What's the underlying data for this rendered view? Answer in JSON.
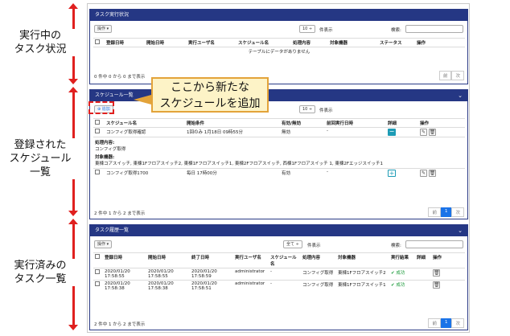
{
  "annotations": {
    "running": "実行中の\nタスク状況",
    "registered": "登録された\nスケジュール\n一覧",
    "executed": "実行済みの\nタスク一覧",
    "callout": "ここから新たな\nスケジュールを追加"
  },
  "colors": {
    "header": "#253784",
    "arrow": "#e0201f",
    "callout_bg": "#fdf3c7",
    "callout_border": "#e3a33a",
    "success": "#1a9a3a",
    "page_active": "#1a73e8"
  },
  "panel1": {
    "title": "タスク実行状況",
    "op_button": "操作 ▾",
    "page_size": "10 ÷",
    "page_size_suffix": "件表示",
    "search_label": "検索:",
    "columns": [
      "登録日時",
      "開始日時",
      "実行ユーザ名",
      "スケジュール名",
      "処理内容",
      "対象機器",
      "ステータス",
      "操作"
    ],
    "empty": "テーブルにデータがありません",
    "info": "0 件中 0 から 0 まで表示",
    "prev": "前",
    "next": "次"
  },
  "panel2": {
    "title": "スケジュール一覧",
    "add_button": "追加",
    "page_size": "10 ÷",
    "page_size_suffix": "件表示",
    "columns": [
      "スケジュール名",
      "開始条件",
      "有効/無効",
      "前回実行日時",
      "詳細",
      "操作"
    ],
    "rows": [
      {
        "name": "コンフィグ取得確認",
        "condition": "1回のみ 1月18日 09時55分",
        "enabled": "無効",
        "last": "-"
      },
      {
        "name": "コンフィグ取得1700",
        "condition": "毎日 17時00分",
        "enabled": "有効",
        "last": "-"
      }
    ],
    "detail_process_label": "処理内容:",
    "detail_process": "コンフィグ取得",
    "detail_target_label": "対象機器:",
    "detail_target": "東棟コアスイッチ, 東棟1Fフロアスイッチ2, 東棟1Fフロアスイッチ1, 東棟2Fフロアスイッチ, 西棟1Fフロアスイッチ 1, 東棟2Fエッジスイッチ1",
    "info": "2 件中 1 から 2 まで表示",
    "prev": "前",
    "page": "1",
    "next": "次"
  },
  "panel3": {
    "title": "タスク履歴一覧",
    "op_button": "操作 ▾",
    "page_size": "全て ÷",
    "page_size_suffix": "件表示",
    "search_label": "検索:",
    "columns": [
      "登録日時",
      "開始日時",
      "終了日時",
      "実行ユーザ名",
      "スケジュール名",
      "処理内容",
      "対象機器",
      "実行結果",
      "詳細",
      "操作"
    ],
    "rows": [
      {
        "reg": "2020/01/20 17:58:55",
        "start": "2020/01/20 17:58:55",
        "end": "2020/01/20 17:58:59",
        "user": "administrator",
        "schedule": "-",
        "process": "コンフィグ取得",
        "target": "東棟1Fフロアスイッチ2",
        "result": "成功"
      },
      {
        "reg": "2020/01/20 17:58:38",
        "start": "2020/01/20 17:58:38",
        "end": "2020/01/20 17:58:51",
        "user": "administrator",
        "schedule": "-",
        "process": "コンフィグ取得",
        "target": "東棟1Fフロアスイッチ1",
        "result": "成功"
      }
    ],
    "info": "2 件中 1 から 2 まで表示",
    "prev": "前",
    "page": "1",
    "next": "次"
  }
}
